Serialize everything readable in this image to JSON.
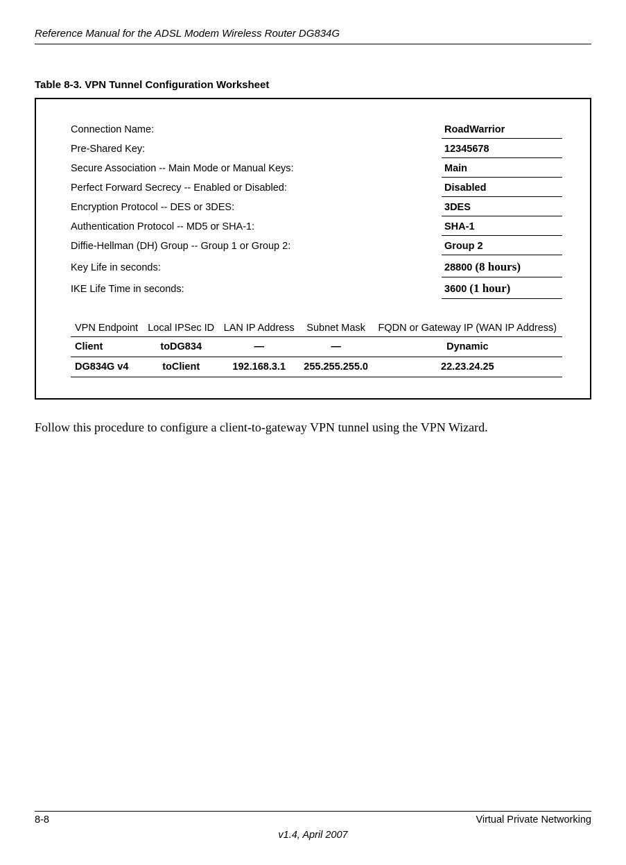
{
  "header": {
    "doc_title": "Reference Manual for the ADSL Modem Wireless Router DG834G"
  },
  "table_caption": "Table 8-3. VPN Tunnel Configuration Worksheet",
  "worksheet": {
    "rows": [
      {
        "label": "Connection Name:",
        "value": "RoadWarrior"
      },
      {
        "label": "Pre-Shared Key:",
        "value": "12345678"
      },
      {
        "label": "Secure Association -- Main Mode or Manual Keys:",
        "value": "Main"
      },
      {
        "label": "Perfect Forward Secrecy -- Enabled or Disabled:",
        "value": "Disabled"
      },
      {
        "label": "Encryption Protocol -- DES or 3DES:",
        "value": "3DES"
      },
      {
        "label": "Authentication Protocol -- MD5 or SHA-1:",
        "value": "SHA-1"
      },
      {
        "label": "Diffie-Hellman (DH) Group -- Group 1 or Group 2:",
        "value": "Group 2"
      },
      {
        "label": "Key Life in seconds:",
        "value": "28800",
        "extra": "(8 hours)"
      },
      {
        "label": "IKE Life Time in seconds:",
        "value": "3600",
        "extra": "(1 hour)"
      }
    ],
    "endpoint_headers": {
      "c1": "VPN Endpoint",
      "c2": "Local IPSec ID",
      "c3": "LAN IP Address",
      "c4": "Subnet Mask",
      "c5": "FQDN or Gateway IP (WAN IP Address)"
    },
    "endpoint_rows": [
      {
        "c1": "Client",
        "c2": "toDG834",
        "c3": "—",
        "c4": "—",
        "c5": "Dynamic"
      },
      {
        "c1": "DG834G v4",
        "c2": "toClient",
        "c3": "192.168.3.1",
        "c4": "255.255.255.0",
        "c5": "22.23.24.25"
      }
    ]
  },
  "body_paragraph": "Follow this procedure to configure a client-to-gateway VPN tunnel using the VPN Wizard.",
  "footer": {
    "page": "8-8",
    "section": "Virtual Private Networking",
    "version": "v1.4, April 2007"
  }
}
